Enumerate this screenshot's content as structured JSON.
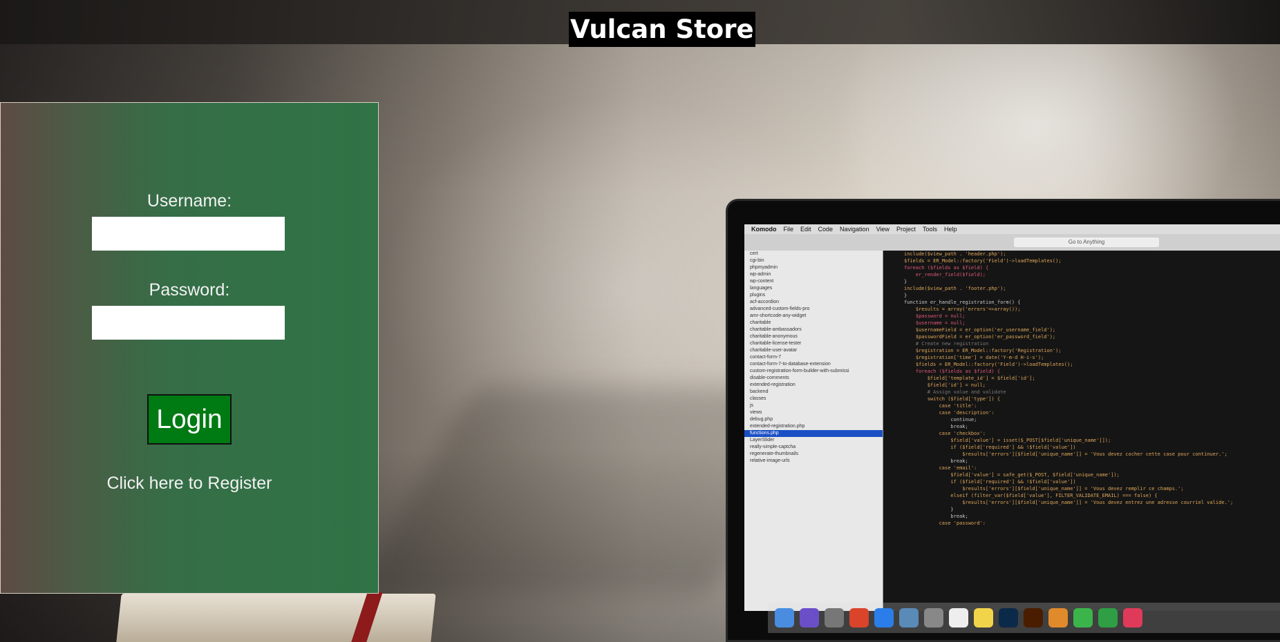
{
  "header": {
    "site_title": "Vulcan Store"
  },
  "login_form": {
    "username_label": "Username:",
    "username_value": "",
    "password_label": "Password:",
    "password_value": "",
    "login_button_label": "Login",
    "register_link_text": "Click here to Register"
  },
  "colors": {
    "login_button": "#007a12",
    "panel_green": "#307345",
    "title_background": "#000000"
  },
  "background_laptop": {
    "menu_items": [
      "Komodo",
      "File",
      "Edit",
      "Code",
      "Navigation",
      "View",
      "Project",
      "Tools",
      "Help"
    ],
    "goto_placeholder": "Go to Anything",
    "sidebar_items": [
      "cert",
      "cgi-bin",
      "phpmyadmin",
      "wp-admin",
      "wp-content",
      "languages",
      "plugins",
      "acf-accordion",
      "advanced-custom-fields-pro",
      "amr-shortcode-any-widget",
      "charitable",
      "charitable-ambassadors",
      "charitable-anonymous",
      "charitable-license-tester",
      "charitable-user-avatar",
      "contact-form-7",
      "contact-form-7-to-database-extension",
      "custom-registration-form-builder-with-submissi",
      "disable-comments",
      "extended-registration",
      "backend",
      "classes",
      "js",
      "views",
      "debug.php",
      "extended-registration.php",
      "functions.php",
      "LayerSlider",
      "really-simple-captcha",
      "regenerate-thumbnails",
      "relative-image-urls"
    ],
    "selected_sidebar_item": "functions.php",
    "code_lines": [
      "include($view_path . 'header.php');",
      "",
      "$fields = ER_Model::factory('Field')->loadTemplates();",
      "foreach ($fields as $field) {",
      "    er_render_field($field);",
      "}",
      "",
      "include($view_path . 'footer.php');",
      "}",
      "",
      "function er_handle_registration_form() {",
      "    $results = array('errors'=>array());",
      "    $password = null;",
      "    $username = null;",
      "    $usernameField = er_option('er_username_field');",
      "    $passwordField = er_option('er_password_field');",
      "",
      "    # Create new registration",
      "    $registration = ER_Model::factory('Registration');",
      "    $registration['time'] = date('Y-m-d H-i-s');",
      "",
      "    $fields = ER_Model::factory('Field')->loadTemplates();",
      "    foreach ($fields as $field) {",
      "        $field['template_id'] = $field['id'];",
      "        $field['id'] = null;",
      "",
      "        # Assign value and validate",
      "        switch ($field['type']) {",
      "            case 'title':",
      "            case 'description':",
      "                continue;",
      "                break;",
      "",
      "            case 'checkbox':",
      "                $field['value'] = isset($_POST[$field['unique_name']]);",
      "                if ($field['required'] && !$field['value'])",
      "                    $results['errors'][$field['unique_name']] = 'Vous devez cocher cette case pour continuer.';",
      "                break;",
      "",
      "            case 'email':",
      "                $field['value'] = safe_get($_POST, $field['unique_name']);",
      "                if ($field['required'] && !$field['value'])",
      "                    $results['errors'][$field['unique_name']] = 'Vous devez remplir ce champs.';",
      "                elseif (filter_var($field['value'], FILTER_VALIDATE_EMAIL) === false) {",
      "                    $results['errors'][$field['unique_name']] = 'Vous devez entrez une adresse courriel valide.';",
      "                }",
      "                break;",
      "",
      "            case 'password':"
    ]
  }
}
